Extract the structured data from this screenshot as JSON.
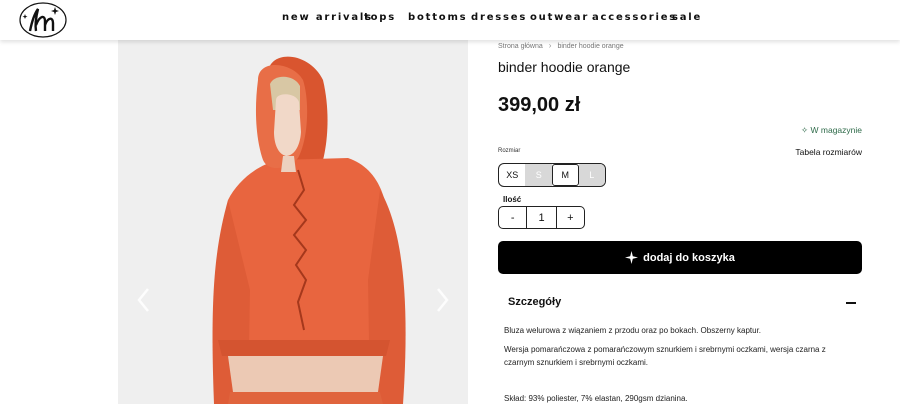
{
  "nav": {
    "items": [
      "new arrivals",
      "tops",
      "bottoms",
      "dresses",
      "outwear",
      "accessories",
      "sale"
    ]
  },
  "breadcrumb": {
    "home": "Strona główna",
    "current": "binder hoodie orange"
  },
  "product": {
    "title": "binder hoodie orange",
    "price": "399,00 zł",
    "stock": "W magazynie",
    "size_table": "Tabela rozmiarów",
    "size_label": "Rozmiar",
    "sizes": [
      {
        "label": "XS",
        "available": true,
        "selected": false
      },
      {
        "label": "S",
        "available": false,
        "selected": false
      },
      {
        "label": "M",
        "available": true,
        "selected": true
      },
      {
        "label": "L",
        "available": false,
        "selected": false
      }
    ],
    "qty_label": "Ilość",
    "qty_minus": "-",
    "qty_value": "1",
    "qty_plus": "+",
    "add_to_cart": "dodaj do koszyka"
  },
  "details": {
    "title": "Szczegóły",
    "p1": "Bluza welurowa z wiązaniem z przodu oraz po bokach. Obszerny kaptur.",
    "p2": "Wersja pomarańczowa z pomarańczowym sznurkiem i srebrnymi oczkami, wersja czarna z czarnym sznurkiem i srebrnymi oczkami.",
    "p3": "Skład: 93% poliester, 7% elastan, 290gsm dzianina."
  },
  "colors": {
    "accent": "#000000",
    "stock_green": "#2f6b4a",
    "hoodie": "#e8653f"
  }
}
